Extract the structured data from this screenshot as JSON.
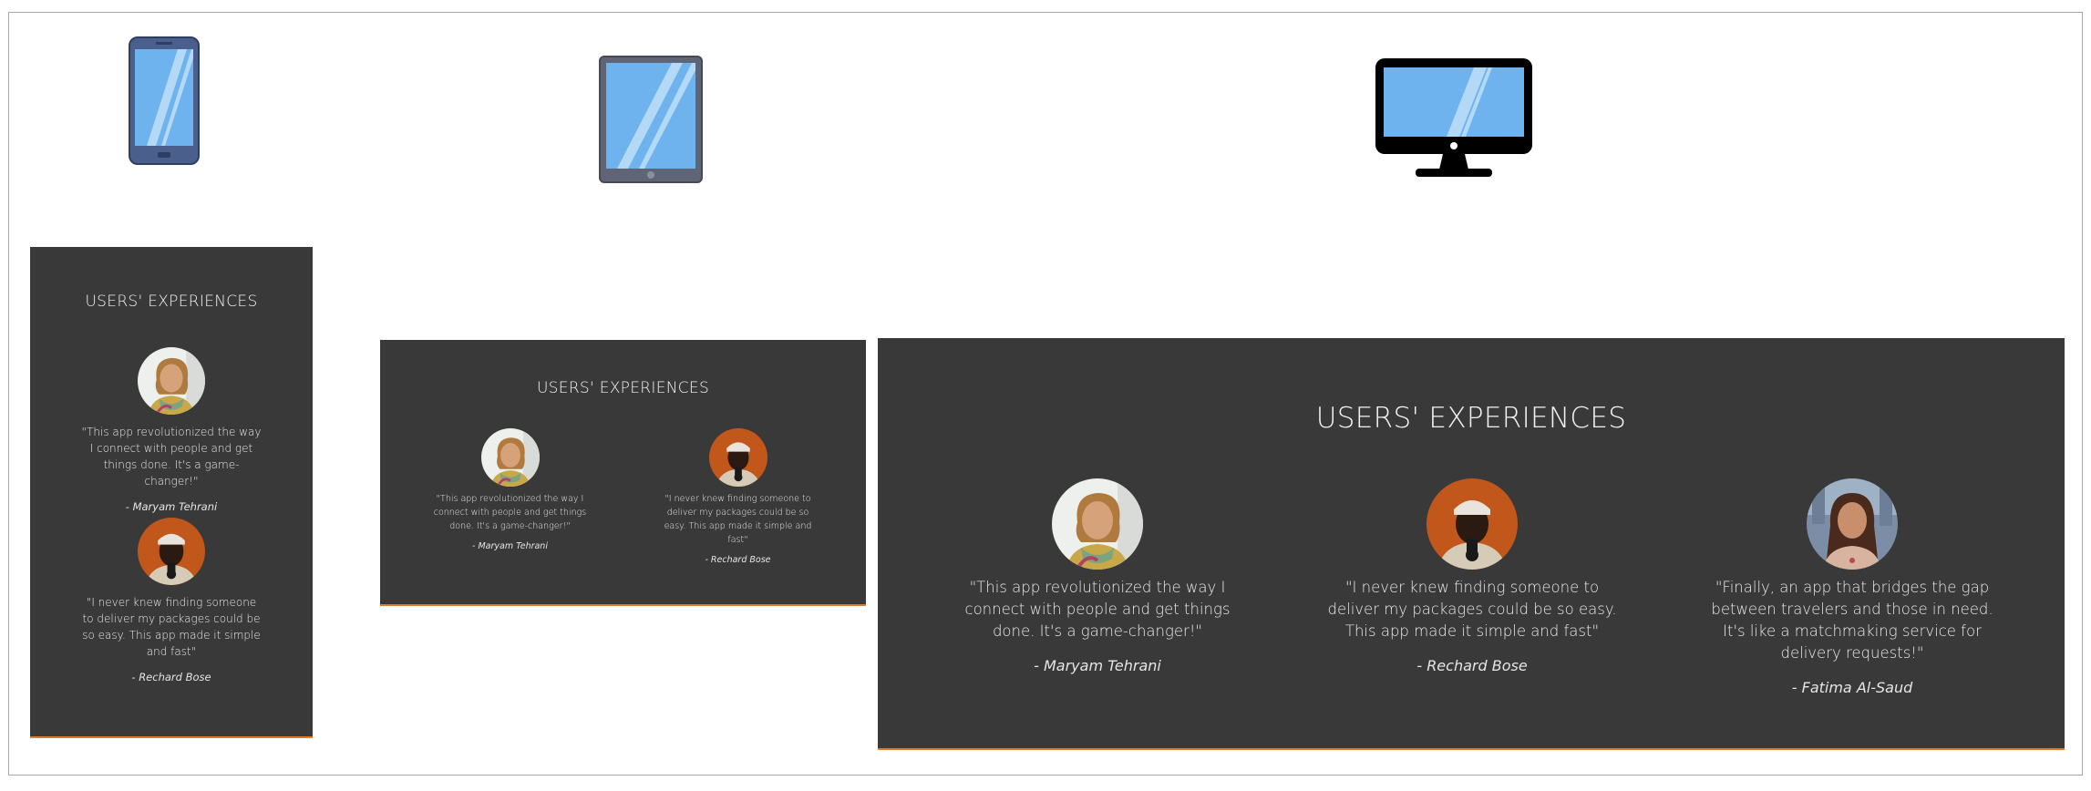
{
  "devices": [
    {
      "name": "mobile",
      "icon": "smartphone-icon"
    },
    {
      "name": "tablet",
      "icon": "tablet-icon"
    },
    {
      "name": "desktop",
      "icon": "desktop-monitor-icon"
    }
  ],
  "colors": {
    "panel_bg": "#3a3939",
    "accent": "#e07a2b",
    "text": "#f0f0f0",
    "screen_blue": "#6eb3ee",
    "phone_frame": "#4a5f8c",
    "tablet_frame": "#5f6576"
  },
  "section": {
    "title": "USERS' EXPERIENCES"
  },
  "testimonials": [
    {
      "quote": "\"This app revolutionized the way I connect with people and get things done. It's a game-changer!\"",
      "author": "- Maryam Tehrani",
      "avatar": "avatar-photo"
    },
    {
      "quote": "\"I never knew finding someone to deliver my packages could be so easy. This app made it simple and fast\"",
      "author": "- Rechard Bose",
      "avatar": "avatar-photo"
    },
    {
      "quote": "\"Finally, an app that bridges the gap between travelers and those in need. It's like a matchmaking service for delivery requests!\"",
      "author": "- Fatima Al-Saud",
      "avatar": "avatar-photo"
    }
  ]
}
